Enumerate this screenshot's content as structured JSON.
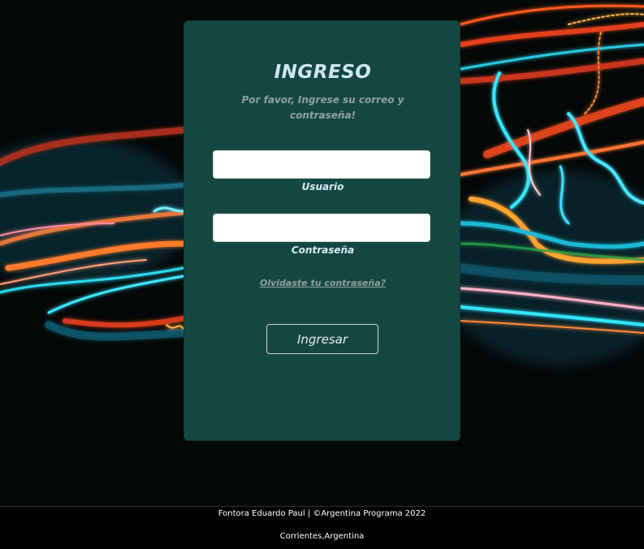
{
  "login": {
    "title": "INGRESO",
    "subtitle": "Por favor, Ingrese su correo y contraseña!",
    "username_label": "Usuario",
    "username_value": "",
    "password_label": "Contraseña",
    "password_value": "",
    "forgot_link": "Olvidaste tu contraseña?",
    "submit_label": "Ingresar"
  },
  "footer": {
    "line1": "Fontora Eduardo Paul | ©Argentina Programa 2022",
    "line2": "Corrientes,Argentina"
  },
  "colors": {
    "card": "#154741",
    "title": "#cfe6f0",
    "muted_text": "#8fa29f",
    "background": "#050807"
  }
}
